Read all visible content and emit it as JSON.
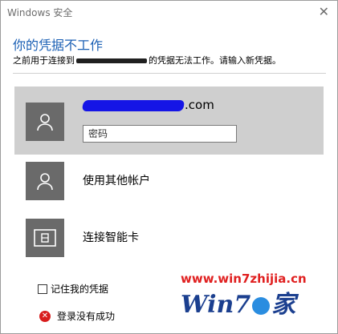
{
  "window": {
    "title": "Windows 安全",
    "close_glyph": "✕"
  },
  "dialog": {
    "heading": "你的凭据不工作",
    "subtitle_before": "之前用于连接到",
    "subtitle_after": "的凭据无法工作。请输入新凭据。"
  },
  "accounts": [
    {
      "name_suffix": ".com",
      "password_placeholder": "密码",
      "icon": "user-icon",
      "selected": true
    },
    {
      "label": "使用其他帐户",
      "icon": "user-icon",
      "selected": false
    },
    {
      "label": "连接智能卡",
      "icon": "smartcard-icon",
      "selected": false
    }
  ],
  "remember": {
    "label": "记住我的凭据",
    "checked": false
  },
  "error": {
    "text": "登录没有成功",
    "icon": "error-icon"
  },
  "watermark": {
    "url": "www.win7zhijia.cn",
    "logo_text_a": "Win7",
    "logo_text_b": "家"
  },
  "colors": {
    "heading": "#1a5fb4",
    "selected_bg": "#cfcfcf",
    "avatar_bg": "#6a6a6a",
    "error": "#d81c1c"
  }
}
